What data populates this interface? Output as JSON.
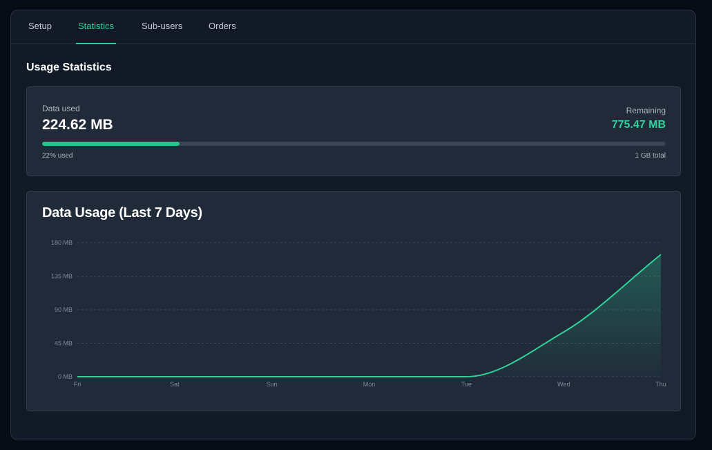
{
  "tabs": [
    {
      "label": "Setup",
      "active": false
    },
    {
      "label": "Statistics",
      "active": true
    },
    {
      "label": "Sub-users",
      "active": false
    },
    {
      "label": "Orders",
      "active": false
    }
  ],
  "section_title": "Usage Statistics",
  "usage": {
    "data_used_label": "Data used",
    "data_used_value": "224.62 MB",
    "remaining_label": "Remaining",
    "remaining_value": "775.47 MB",
    "percent_used": 22,
    "percent_text": "22% used",
    "total_text": "1 GB total"
  },
  "colors": {
    "accent": "#2fd39a",
    "panel_bg": "#121a27",
    "card_bg": "#202a39"
  },
  "chart_data": {
    "type": "area",
    "title": "Data Usage (Last 7 Days)",
    "categories": [
      "Fri",
      "Sat",
      "Sun",
      "Mon",
      "Tue",
      "Wed",
      "Thu"
    ],
    "values": [
      0,
      0,
      0,
      0,
      0,
      60,
      164
    ],
    "ylim": [
      0,
      180
    ],
    "yticks": [
      0,
      45,
      90,
      135,
      180
    ],
    "ytick_labels": [
      "0 MB",
      "45 MB",
      "90 MB",
      "135 MB",
      "180 MB"
    ],
    "grid": true,
    "xlabel": "",
    "ylabel": ""
  }
}
